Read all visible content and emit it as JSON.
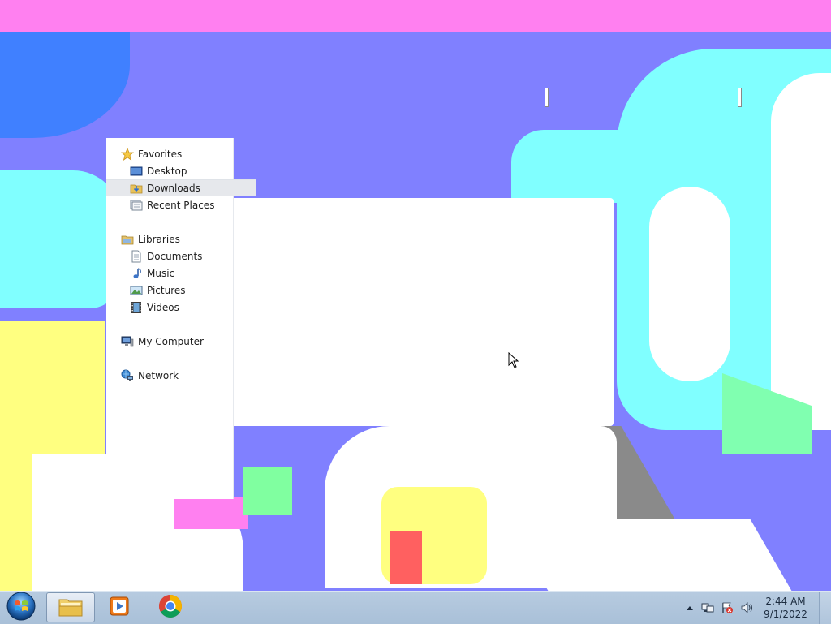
{
  "nav_pane": {
    "favorites": {
      "label": "Favorites",
      "icon": "star-icon",
      "items": [
        {
          "label": "Desktop",
          "icon": "desktop-icon"
        },
        {
          "label": "Downloads",
          "icon": "downloads-folder-icon",
          "selected": true
        },
        {
          "label": "Recent Places",
          "icon": "recent-places-icon"
        }
      ]
    },
    "libraries": {
      "label": "Libraries",
      "icon": "libraries-icon",
      "items": [
        {
          "label": "Documents",
          "icon": "document-icon"
        },
        {
          "label": "Music",
          "icon": "music-note-icon"
        },
        {
          "label": "Pictures",
          "icon": "picture-icon"
        },
        {
          "label": "Videos",
          "icon": "film-icon"
        }
      ]
    },
    "computer": {
      "label": "My Computer",
      "icon": "computer-icon"
    },
    "network": {
      "label": "Network",
      "icon": "network-icon"
    }
  },
  "taskbar": {
    "start_icon": "windows-orb-icon",
    "pinned": [
      {
        "name": "Windows Explorer",
        "icon": "explorer-folder-icon",
        "active": true
      },
      {
        "name": "Media Player",
        "icon": "media-player-icon",
        "active": false
      },
      {
        "name": "Google Chrome",
        "icon": "chrome-icon",
        "active": false
      }
    ],
    "tray": {
      "icons": [
        "show-hidden-icons-arrow",
        "network-tray-icon",
        "action-center-flag-icon",
        "volume-icon"
      ],
      "time": "2:44 AM",
      "date": "9/1/2022"
    }
  },
  "colors": {
    "taskbar": "#b0c6dc",
    "selection": "#e6e8ec",
    "wallpaper_base": "#8080ff"
  }
}
